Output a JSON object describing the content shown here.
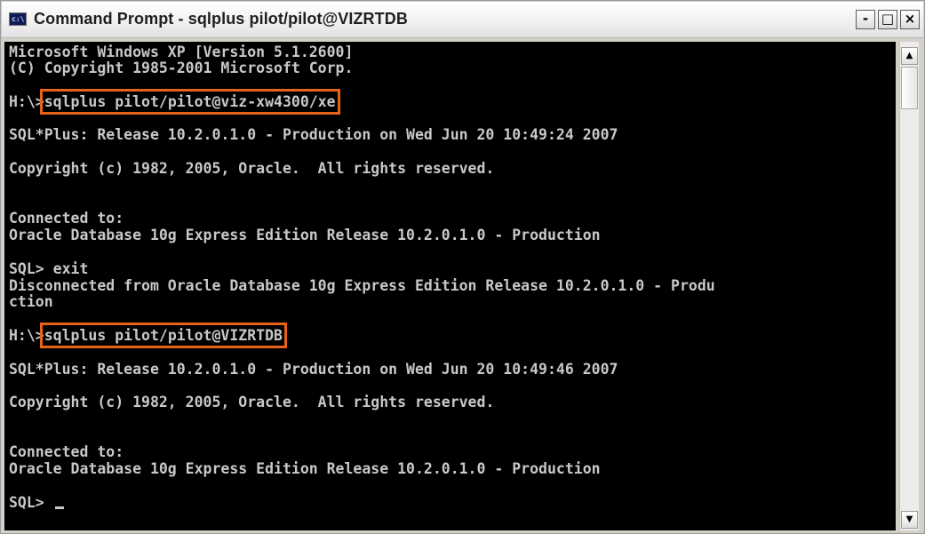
{
  "window": {
    "title": "Command Prompt - sqlplus pilot/pilot@VIZRTDB",
    "app_icon_text": "c:\\",
    "minimize_symbol": "-",
    "maximize_symbol": "□",
    "close_symbol": "×"
  },
  "console": {
    "lines": [
      {
        "text": "Microsoft Windows XP [Version 5.1.2600]"
      },
      {
        "text": "(C) Copyright 1985-2001 Microsoft Corp."
      },
      {
        "prompt": "H:\\>",
        "command": "sqlplus pilot/pilot@viz-xw4300/xe",
        "highlighted": true
      },
      {
        "text": "SQL*Plus: Release 10.2.0.1.0 - Production on Wed Jun 20 10:49:24 2007"
      },
      {
        "text": "Copyright (c) 1982, 2005, Oracle.  All rights reserved."
      },
      {
        "text": "Connected to:"
      },
      {
        "text": "Oracle Database 10g Express Edition Release 10.2.0.1.0 - Production"
      },
      {
        "text": "SQL> exit"
      },
      {
        "text": "Disconnected from Oracle Database 10g Express Edition Release 10.2.0.1.0 - Produ"
      },
      {
        "text": "ction"
      },
      {
        "prompt": "H:\\>",
        "command": "sqlplus pilot/pilot@VIZRTDB",
        "highlighted": true
      },
      {
        "text": "SQL*Plus: Release 10.2.0.1.0 - Production on Wed Jun 20 10:49:46 2007"
      },
      {
        "text": "Copyright (c) 1982, 2005, Oracle.  All rights reserved."
      },
      {
        "text": "Connected to:"
      },
      {
        "text": "Oracle Database 10g Express Edition Release 10.2.0.1.0 - Production"
      },
      {
        "prompt": "SQL> ",
        "cursor": true
      }
    ]
  },
  "scrollbar": {
    "up_symbol": "▲",
    "down_symbol": "▼",
    "position": 0
  },
  "colors": {
    "console_background": "#000000",
    "console_text": "#c8c8c8",
    "highlight_box": "#e8631a"
  },
  "icons": {
    "app": "command-prompt-icon",
    "minimize": "minimize-icon",
    "maximize": "maximize-icon",
    "close": "close-icon",
    "scroll_up": "scroll-up-arrow-icon",
    "scroll_down": "scroll-down-arrow-icon"
  }
}
